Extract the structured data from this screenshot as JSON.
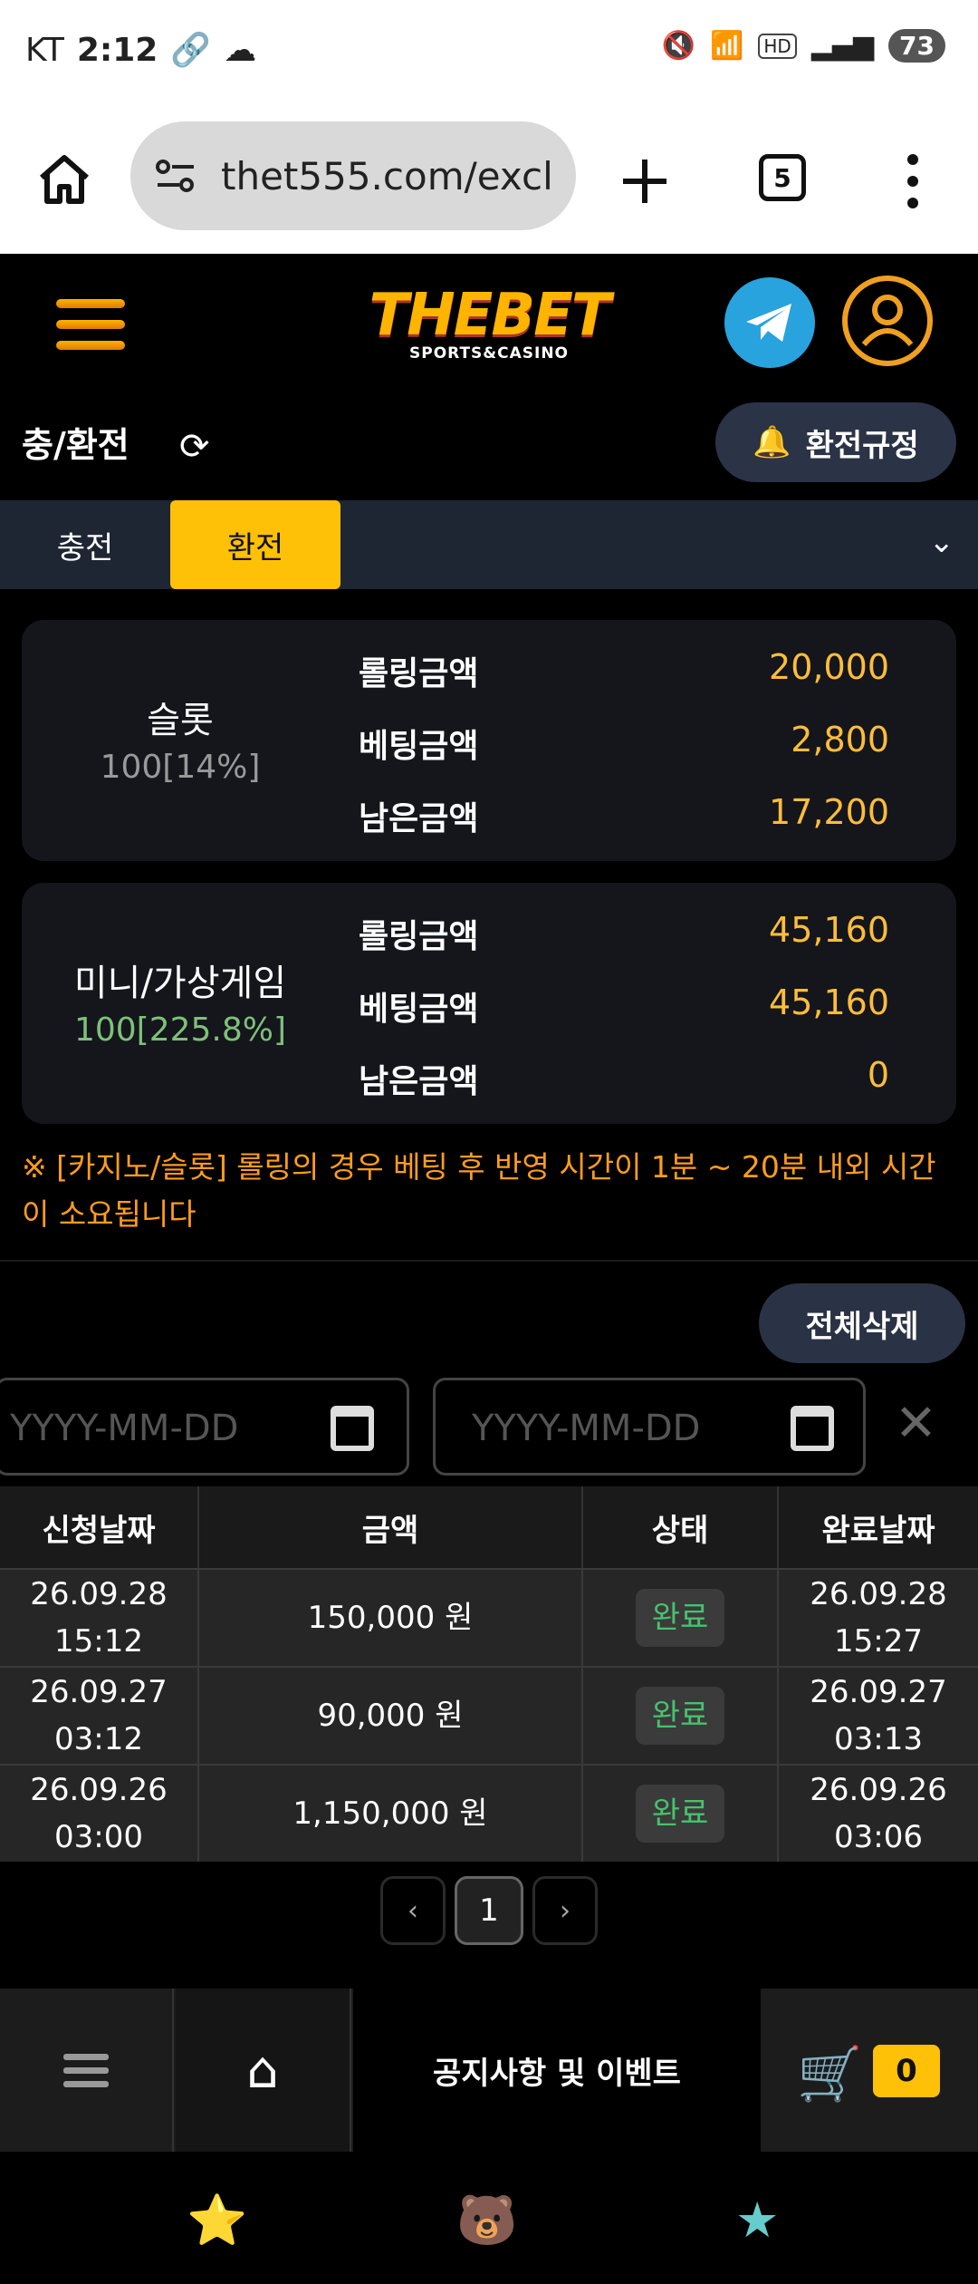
{
  "status_bar": {
    "carrier": "KT",
    "time": "2:12",
    "battery": "73"
  },
  "browser": {
    "url": "thet555.com/excl",
    "tab_count": "5"
  },
  "site": {
    "logo_main": "THEBET",
    "logo_sub": "SPORTS&CASINO"
  },
  "page": {
    "title": "충/환전",
    "rules_button": "환전규정"
  },
  "tabs": [
    {
      "label": "충전"
    },
    {
      "label": "환전"
    }
  ],
  "cards": [
    {
      "name": "슬롯",
      "percent": "100[14%]",
      "rows": [
        {
          "label": "롤링금액",
          "value": "20,000"
        },
        {
          "label": "베팅금액",
          "value": "2,800"
        },
        {
          "label": "남은금액",
          "value": "17,200"
        }
      ]
    },
    {
      "name": "미니/가상게임",
      "percent": "100[225.8%]",
      "rows": [
        {
          "label": "롤링금액",
          "value": "45,160"
        },
        {
          "label": "베팅금액",
          "value": "45,160"
        },
        {
          "label": "남은금액",
          "value": "0"
        }
      ]
    }
  ],
  "notice": "※ [카지노/슬롯] 롤링의 경우 베팅 후 반영 시간이 1분 ~ 20분 내외 시간이 소요됩니다",
  "delete_all": "전체삭제",
  "date_filter": {
    "start_placeholder": "YYYY-MM-DD",
    "end_placeholder": "YYYY-MM-DD"
  },
  "table": {
    "headers": [
      "신청날짜",
      "금액",
      "상태",
      "완료날짜"
    ],
    "rows": [
      {
        "req_date": "26.09.28",
        "req_time": "15:12",
        "amount": "150,000 원",
        "status": "완료",
        "done_date": "26.09.28",
        "done_time": "15:27"
      },
      {
        "req_date": "26.09.27",
        "req_time": "03:12",
        "amount": "90,000 원",
        "status": "완료",
        "done_date": "26.09.27",
        "done_time": "03:13"
      },
      {
        "req_date": "26.09.26",
        "req_time": "03:00",
        "amount": "1,150,000 원",
        "status": "완료",
        "done_date": "26.09.26",
        "done_time": "03:06"
      }
    ]
  },
  "pagination": {
    "prev": "‹",
    "current": "1",
    "next": "›"
  },
  "bottom_nav": {
    "notice_label": "공지사항 및 이벤트",
    "cart_count": "0"
  }
}
